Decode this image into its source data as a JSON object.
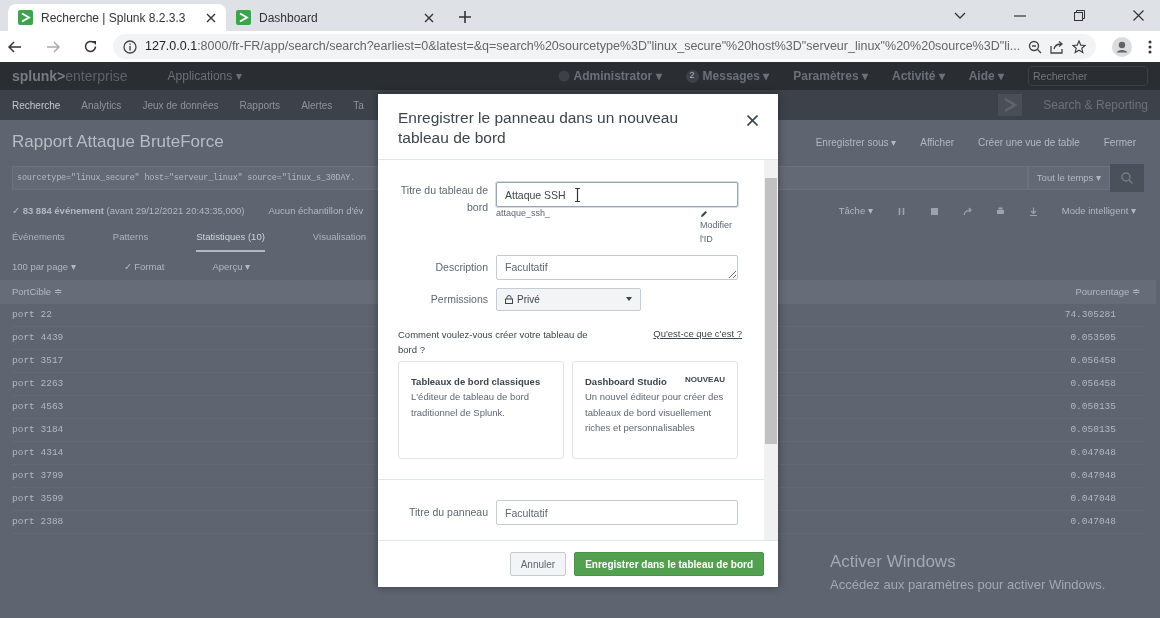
{
  "browser": {
    "tabs": [
      {
        "title": "Recherche | Splunk 8.2.3.3",
        "selected": true
      },
      {
        "title": "Dashboard",
        "selected": false
      }
    ],
    "url_host": "127.0.0.1",
    "url_rest": ":8000/fr-FR/app/search/search?earliest=0&latest=&q=search%20sourcetype%3D\"linux_secure\"%20host%3D\"serveur_linux\"%20%20source%3D\"li..."
  },
  "splunk": {
    "brand": "splunk>",
    "product": "enterprise",
    "apps_menu": "Applications ▾",
    "top_menu": [
      {
        "label": "Administrator ▾"
      },
      {
        "label": "Messages ▾",
        "badge": "2"
      },
      {
        "label": "Paramètres ▾"
      },
      {
        "label": "Activité ▾"
      },
      {
        "label": "Aide ▾"
      }
    ],
    "search_placeholder": "Rechercher",
    "app_nav": [
      {
        "label": "Recherche",
        "selected": true
      },
      {
        "label": "Analytics",
        "selected": false
      },
      {
        "label": "Jeux de données",
        "selected": false
      },
      {
        "label": "Rapports",
        "selected": false
      },
      {
        "label": "Alertes",
        "selected": false
      },
      {
        "label": "Ta",
        "selected": false
      }
    ],
    "app_title": "Search & Reporting"
  },
  "report": {
    "title": "Rapport Attaque BruteForce",
    "actions": [
      "Enregistrer sous ▾",
      "Afficher",
      "Créer une vue de table",
      "Fermer"
    ],
    "query": "sourcetype=\"linux_secure\" host=\"serveur_linux\"  source=\"linux_s_30DAY.",
    "time_range": "Tout le temps ▾",
    "summary": "✓ **83 884 événement** (avant 29/12/2021 20:43:35,000)",
    "sampling": "Aucun échantillon d'év",
    "job_menu": "Tâche ▾",
    "mode": "Mode intelligent ▾",
    "tabs": [
      {
        "label": "Événements",
        "selected": false
      },
      {
        "label": "Patterns",
        "selected": false
      },
      {
        "label": "Statistiques (10)",
        "selected": true
      },
      {
        "label": "Visualisation",
        "selected": false
      }
    ],
    "toolbar": [
      "100 par page ▾",
      "✓ Format",
      "Aperçu ▾"
    ],
    "table": {
      "columns": [
        "PortCible ≑",
        "Pourcentage ≑"
      ],
      "rows": [
        [
          "port 22",
          "74.305281"
        ],
        [
          "port 4439",
          "0.053505"
        ],
        [
          "port 3517",
          "0.056458"
        ],
        [
          "port 2263",
          "0.056458"
        ],
        [
          "port 4563",
          "0.050135"
        ],
        [
          "port 3184",
          "0.050135"
        ],
        [
          "port 4314",
          "0.047048"
        ],
        [
          "port 3799",
          "0.047048"
        ],
        [
          "port 3599",
          "0.047048"
        ],
        [
          "port 2388",
          "0.047048"
        ]
      ]
    }
  },
  "modal": {
    "title": "Enregistrer le panneau dans un nouveau tableau de bord",
    "dashboard_title_label": "Titre du tableau de bord",
    "dashboard_title_value": "Attaque SSH",
    "dashboard_id": "attaque_ssh_",
    "edit_id": "Modifier l'ID",
    "description_label": "Description",
    "description_placeholder": "Facultatif",
    "permissions_label": "Permissions",
    "permissions_value": "Privé",
    "question": "Comment voulez-vous créer votre tableau de bord ?",
    "help_link": "Qu'est-ce que c'est ?",
    "options": [
      {
        "title": "Tableaux de bord classiques",
        "text": "L'éditeur de tableau de bord traditionnel de Splunk.",
        "selected": false
      },
      {
        "title": "Dashboard Studio",
        "badge": "NOUVEAU",
        "text": "Un nouvel éditeur pour créer des tableaux de bord visuellement riches et personnalisables",
        "selected": false
      }
    ],
    "panel_title_label": "Titre du panneau",
    "panel_title_placeholder": "Facultatif",
    "buttons": [
      {
        "label": "Annuler",
        "kind": "secondary"
      },
      {
        "label": "Enregistrer dans le tableau de bord",
        "kind": "primary"
      }
    ]
  },
  "os_notice": {
    "title": "Activer Windows",
    "text": "Accédez aux paramètres pour activer Windows."
  }
}
